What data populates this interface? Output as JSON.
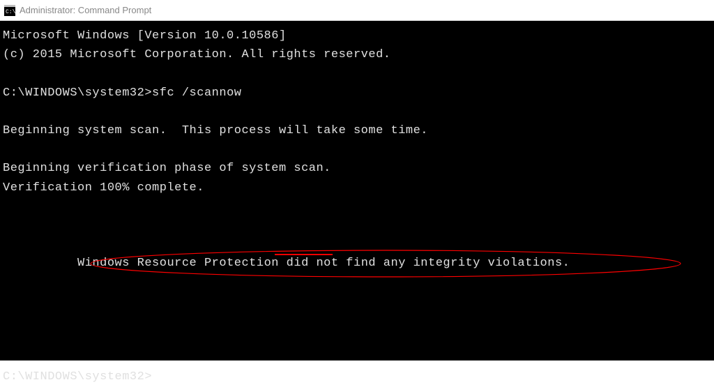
{
  "window": {
    "title": "Administrator: Command Prompt"
  },
  "terminal": {
    "lines": {
      "banner1": "Microsoft Windows [Version 10.0.10586]",
      "banner2": "(c) 2015 Microsoft Corporation. All rights reserved.",
      "prompt1_path": "C:\\WINDOWS\\system32>",
      "prompt1_cmd": "sfc /scannow",
      "begin_scan": "Beginning system scan.  This process will take some time.",
      "verify_phase": "Beginning verification phase of system scan.",
      "verify_done": "Verification 100% complete.",
      "result": "Windows Resource Protection did not find any integrity violations.",
      "prompt2_path": "C:\\WINDOWS\\system32>"
    }
  },
  "annotation": {
    "underlined_phrase": "did not",
    "circle_color": "#ff0000"
  }
}
